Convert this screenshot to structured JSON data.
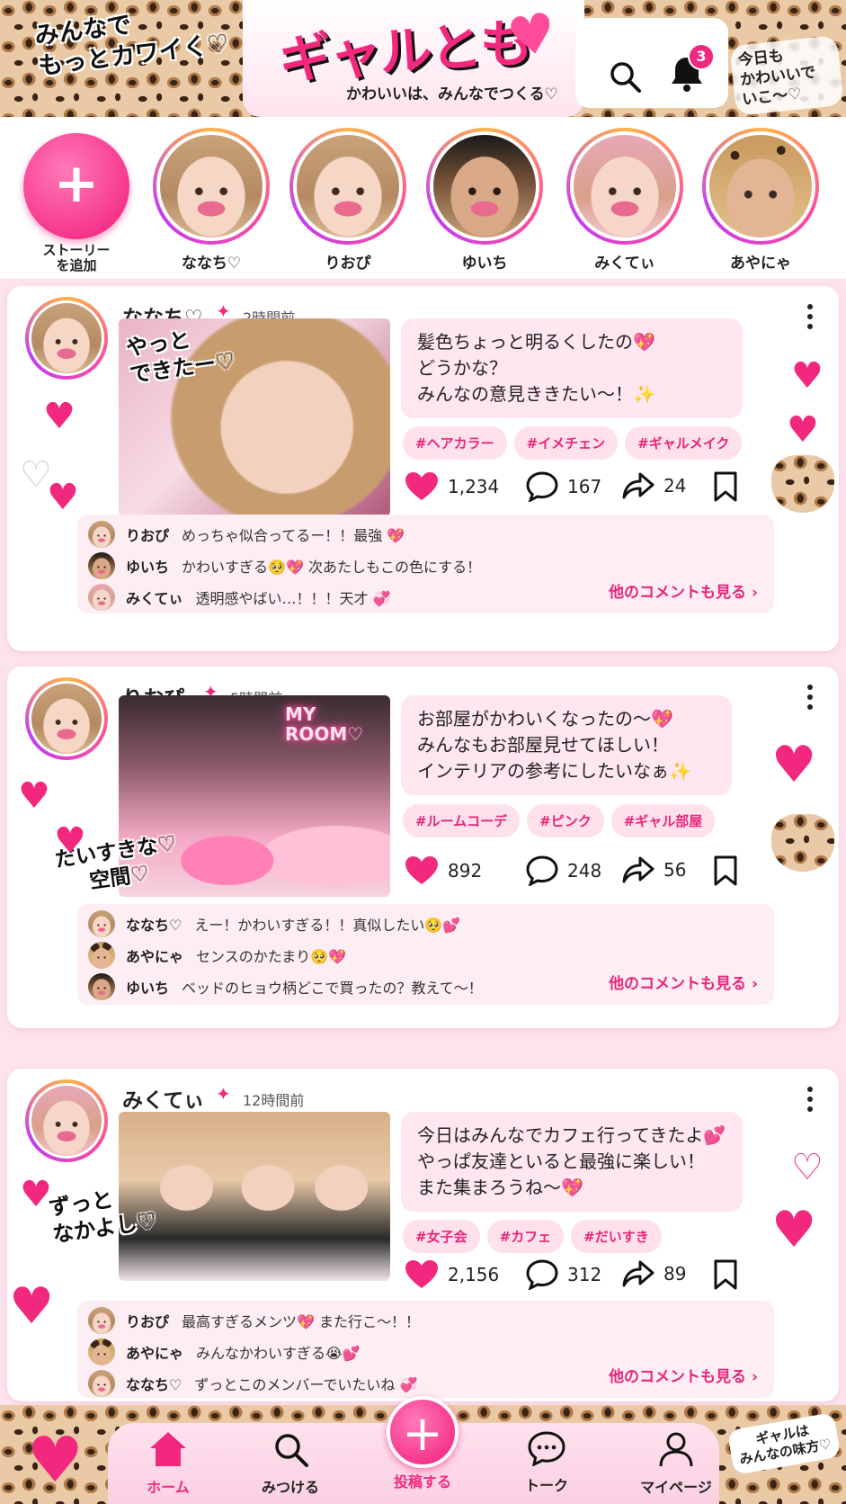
{
  "header": {
    "slogan_line1": "みんなで",
    "slogan_line2": "もっとカワイく♡",
    "logo": "ギャルとも",
    "tagline": "かわいいは、みんなでつくる♡",
    "notification_count": "3",
    "today_line1": "今日も",
    "today_line2": "かわいいで",
    "today_line3": "いこ〜♡"
  },
  "stories": {
    "add_label_line1": "ストーリー",
    "add_label_line2": "を追加",
    "items": [
      {
        "name": "ななち♡"
      },
      {
        "name": "りおぴ"
      },
      {
        "name": "ゆいち"
      },
      {
        "name": "みくてぃ"
      },
      {
        "name": "あやにゃ"
      }
    ]
  },
  "posts": [
    {
      "user": "ななち♡",
      "time": "2時間前",
      "photo_caption_line1": "やっと",
      "photo_caption_line2": "できたー♡",
      "text": [
        "髪色ちょっと明るくしたの💖",
        "どうかな？",
        "みんなの意見ききたい〜！✨"
      ],
      "tags": [
        "#ヘアカラー",
        "#イメチェン",
        "#ギャルメイク"
      ],
      "likes": "1,234",
      "comments_count": "167",
      "shares": "24",
      "comments": [
        {
          "name": "りおぴ",
          "text": "めっちゃ似合ってるー！！最強 💖"
        },
        {
          "name": "ゆいち",
          "text": "かわいすぎる🥺💖 次あたしもこの色にする！"
        },
        {
          "name": "みくてぃ",
          "text": "透明感やばい…！！！天才 💞"
        }
      ],
      "more_label": "他のコメントも見る ›"
    },
    {
      "user": "りおぴ",
      "time": "5時間前",
      "neon_line1": "MY",
      "neon_line2": "ROOM♡",
      "photo_caption_line1": "だいすきな♡",
      "photo_caption_line2": "空間♡",
      "text": [
        "お部屋がかわいくなったの〜💖",
        "みんなもお部屋見せてほしい！",
        "インテリアの参考にしたいなぁ✨"
      ],
      "tags": [
        "#ルームコーデ",
        "#ピンク",
        "#ギャル部屋"
      ],
      "likes": "892",
      "comments_count": "248",
      "shares": "56",
      "comments": [
        {
          "name": "ななち♡",
          "text": "えー！かわいすぎる！！真似したい🥺💕"
        },
        {
          "name": "あやにゃ",
          "text": "センスのかたまり🥺💖"
        },
        {
          "name": "ゆいち",
          "text": "ベッドのヒョウ柄どこで買ったの？教えて〜！"
        }
      ],
      "more_label": "他のコメントも見る ›"
    },
    {
      "user": "みくてぃ",
      "time": "12時間前",
      "photo_caption_line1": "ずっと",
      "photo_caption_line2": "なかよし♡",
      "text": [
        "今日はみんなでカフェ行ってきたよ💕",
        "やっぱ友達といると最強に楽しい！",
        "また集まろうね〜💖"
      ],
      "tags": [
        "#女子会",
        "#カフェ",
        "#だいすき"
      ],
      "likes": "2,156",
      "comments_count": "312",
      "shares": "89",
      "comments": [
        {
          "name": "りおぴ",
          "text": "最高すぎるメンツ💖 また行こ〜！！"
        },
        {
          "name": "あやにゃ",
          "text": "みんなかわいすぎる😭💕"
        },
        {
          "name": "ななち♡",
          "text": "ずっとこのメンバーでいたいね 💞"
        }
      ],
      "more_label": "他のコメントも見る ›"
    }
  ],
  "nav": {
    "home": "ホーム",
    "discover": "みつける",
    "post": "投稿する",
    "talk": "トーク",
    "mypage": "マイページ",
    "sign_line1": "ギャルは",
    "sign_line2": "みんなの味方♡"
  },
  "colors": {
    "accent": "#f2287e",
    "bubble": "#ffe6f0",
    "tag_bg": "#ffe1ec"
  }
}
